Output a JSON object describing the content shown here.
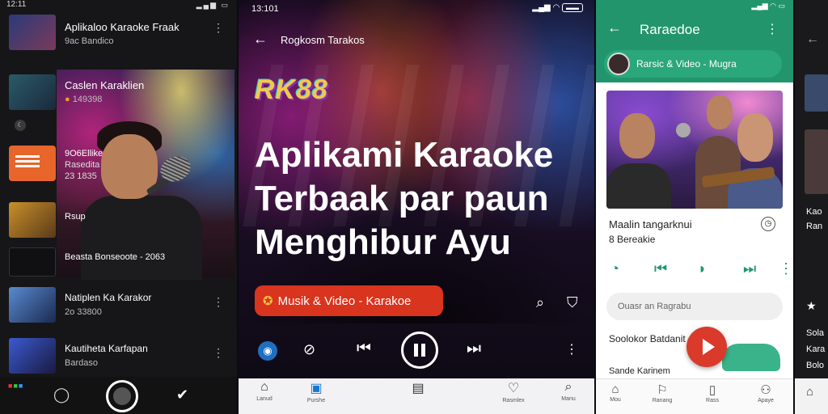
{
  "panel1": {
    "status_time": "12:11",
    "items": [
      {
        "title": "Aplikaloo Karaoke Fraak",
        "sub": "9ac Bandico"
      },
      {
        "title": "Caslen Karaklien",
        "sub": "149398"
      },
      {
        "title": "9O6Ellike",
        "sub": "Rasedita"
      },
      {
        "title": "23 1835",
        "sub": ""
      },
      {
        "title": "Rsup",
        "sub": ""
      },
      {
        "title": "Beasta Bonseoote - 2063",
        "sub": ""
      },
      {
        "title": "Natiplen Ka Karakor",
        "sub": "2o 33800"
      },
      {
        "title": "Kautiheta Karfapan",
        "sub": "Bardaso"
      }
    ]
  },
  "panel2": {
    "status_time": "13:101",
    "top_title": "Rogkosm Tarakos",
    "logo": "RK88",
    "headline": [
      "Aplikami Karaoke",
      "Terbaak par paun",
      "Menghibur Ayu"
    ],
    "pill_label": "Musik & Video - Karakoe",
    "nav": [
      "Lanud",
      "Purshe",
      "",
      "Rasmlex",
      "Manu"
    ]
  },
  "panel3": {
    "title": "Raraedoe",
    "chip_label": "Rarsic & Video - Mugra",
    "song_title": "Maalin tangarknui",
    "song_sub": "8 Bereakie",
    "search_placeholder": "Ouasr an Ragrabu",
    "line1": "Soolokor Batdanit",
    "line2": "Sande Karinem",
    "nav": [
      "Mou",
      "Ranang",
      "Rass",
      "Apaye"
    ]
  },
  "panel4": {
    "lines": [
      "Kao",
      "Ran",
      "Sola",
      "Kara",
      "Bolo"
    ]
  }
}
